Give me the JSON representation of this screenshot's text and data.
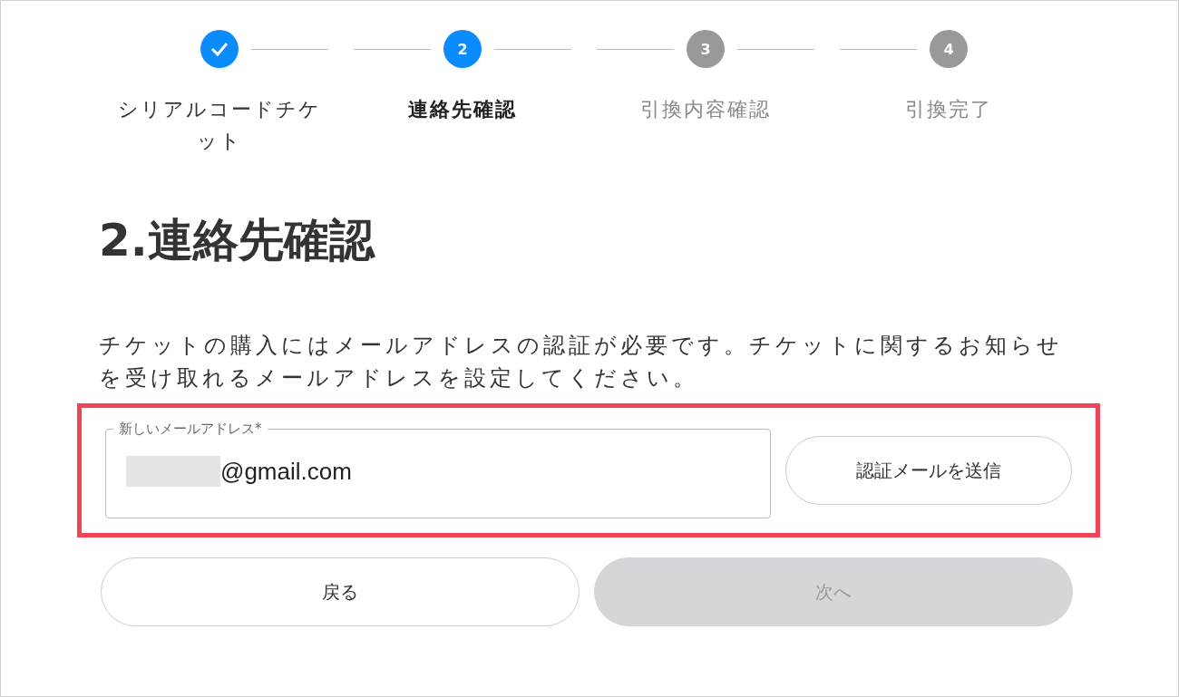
{
  "steps": [
    {
      "label": "シリアルコードチケット",
      "completed": true,
      "selected": false
    },
    {
      "number": "2",
      "label": "連絡先確認",
      "completed": false,
      "selected": true
    },
    {
      "number": "3",
      "label": "引換内容確認",
      "completed": false,
      "selected": false
    },
    {
      "number": "4",
      "label": "引換完了",
      "completed": false,
      "selected": false
    }
  ],
  "heading": "2.連絡先確認",
  "description": "チケットの購入にはメールアドレスの認証が必要です。チケットに関するお知らせを受け取れるメールアドレスを設定してください。",
  "email": {
    "label": "新しいメールアドレス*",
    "value": "@gmail.com",
    "redacted": true,
    "highlighted": true,
    "send_button": "認証メールを送信"
  },
  "buttons": [
    {
      "label": "戻る",
      "disabled": false
    },
    {
      "label": "次へ",
      "disabled": true
    }
  ]
}
